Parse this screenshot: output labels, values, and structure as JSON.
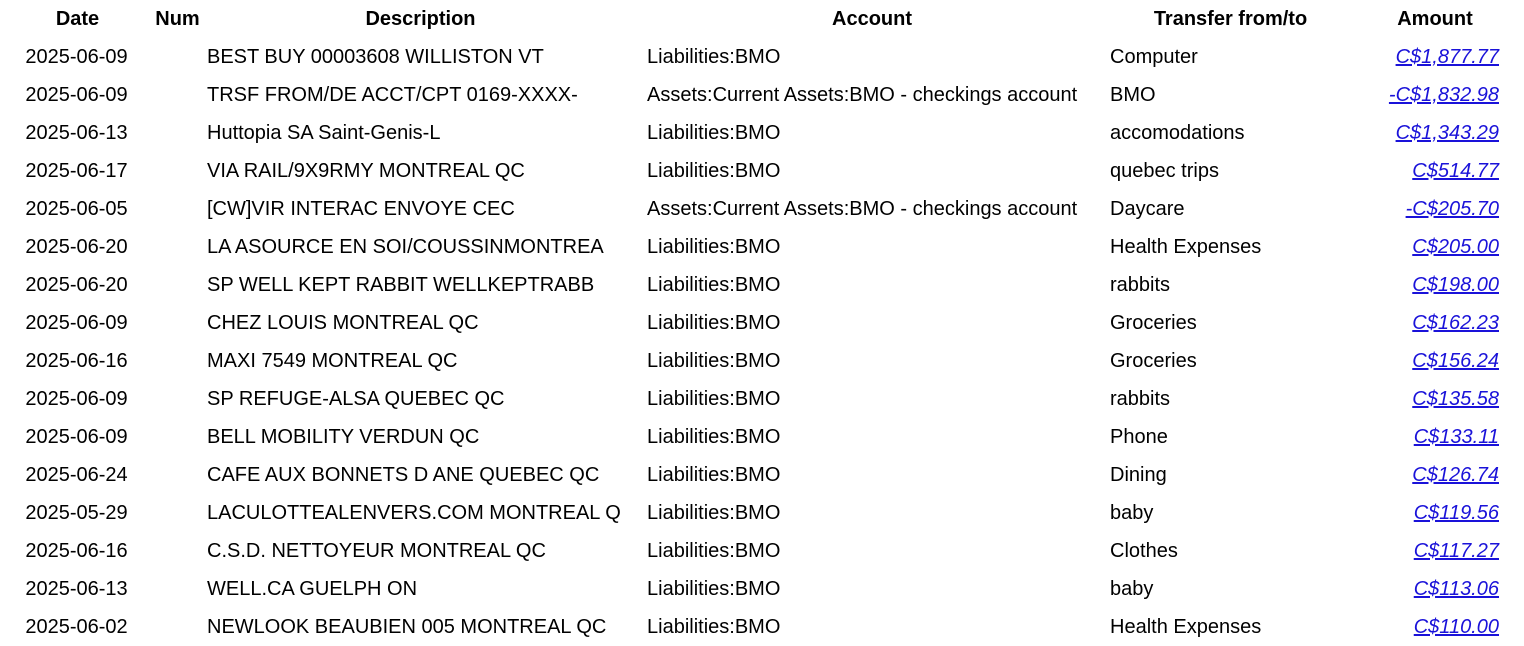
{
  "header": {
    "date": "Date",
    "num": "Num",
    "description": "Description",
    "account": "Account",
    "transfer": "Transfer from/to",
    "amount": "Amount"
  },
  "colors": {
    "link": "#1a12d9",
    "text": "#000000",
    "background": "#ffffff"
  },
  "rows": [
    {
      "date": "2025-06-09",
      "num": "",
      "description": "BEST BUY 00003608 WILLISTON VT",
      "account": "Liabilities:BMO",
      "transfer": "Computer",
      "amount": "C$1,877.77"
    },
    {
      "date": "2025-06-09",
      "num": "",
      "description": "TRSF FROM/DE ACCT/CPT 0169-XXXX-",
      "account": "Assets:Current Assets:BMO - checkings account",
      "transfer": "BMO",
      "amount": "-C$1,832.98"
    },
    {
      "date": "2025-06-13",
      "num": "",
      "description": "Huttopia SA Saint-Genis-L",
      "account": "Liabilities:BMO",
      "transfer": "accomodations",
      "amount": "C$1,343.29"
    },
    {
      "date": "2025-06-17",
      "num": "",
      "description": "VIA RAIL/9X9RMY MONTREAL QC",
      "account": "Liabilities:BMO",
      "transfer": "quebec trips",
      "amount": "C$514.77"
    },
    {
      "date": "2025-06-05",
      "num": "",
      "description": "[CW]VIR INTERAC ENVOYE CEC",
      "account": "Assets:Current Assets:BMO - checkings account",
      "transfer": "Daycare",
      "amount": "-C$205.70"
    },
    {
      "date": "2025-06-20",
      "num": "",
      "description": "LA ASOURCE EN SOI/COUSSINMONTREA",
      "account": "Liabilities:BMO",
      "transfer": "Health Expenses",
      "amount": "C$205.00"
    },
    {
      "date": "2025-06-20",
      "num": "",
      "description": "SP WELL KEPT RABBIT WELLKEPTRABB",
      "account": "Liabilities:BMO",
      "transfer": "rabbits",
      "amount": "C$198.00"
    },
    {
      "date": "2025-06-09",
      "num": "",
      "description": "CHEZ LOUIS MONTREAL QC",
      "account": "Liabilities:BMO",
      "transfer": "Groceries",
      "amount": "C$162.23"
    },
    {
      "date": "2025-06-16",
      "num": "",
      "description": "MAXI 7549 MONTREAL QC",
      "account": "Liabilities:BMO",
      "transfer": "Groceries",
      "amount": "C$156.24"
    },
    {
      "date": "2025-06-09",
      "num": "",
      "description": "SP REFUGE-ALSA QUEBEC QC",
      "account": "Liabilities:BMO",
      "transfer": "rabbits",
      "amount": "C$135.58"
    },
    {
      "date": "2025-06-09",
      "num": "",
      "description": "BELL MOBILITY VERDUN QC",
      "account": "Liabilities:BMO",
      "transfer": "Phone",
      "amount": "C$133.11"
    },
    {
      "date": "2025-06-24",
      "num": "",
      "description": "CAFE AUX BONNETS D ANE QUEBEC QC",
      "account": "Liabilities:BMO",
      "transfer": "Dining",
      "amount": "C$126.74"
    },
    {
      "date": "2025-05-29",
      "num": "",
      "description": "LACULOTTEALENVERS.COM MONTREAL Q",
      "account": "Liabilities:BMO",
      "transfer": "baby",
      "amount": "C$119.56"
    },
    {
      "date": "2025-06-16",
      "num": "",
      "description": "C.S.D. NETTOYEUR MONTREAL QC",
      "account": "Liabilities:BMO",
      "transfer": "Clothes",
      "amount": "C$117.27"
    },
    {
      "date": "2025-06-13",
      "num": "",
      "description": "WELL.CA GUELPH ON",
      "account": "Liabilities:BMO",
      "transfer": "baby",
      "amount": "C$113.06"
    },
    {
      "date": "2025-06-02",
      "num": "",
      "description": "NEWLOOK BEAUBIEN 005 MONTREAL QC",
      "account": "Liabilities:BMO",
      "transfer": "Health Expenses",
      "amount": "C$110.00"
    }
  ]
}
